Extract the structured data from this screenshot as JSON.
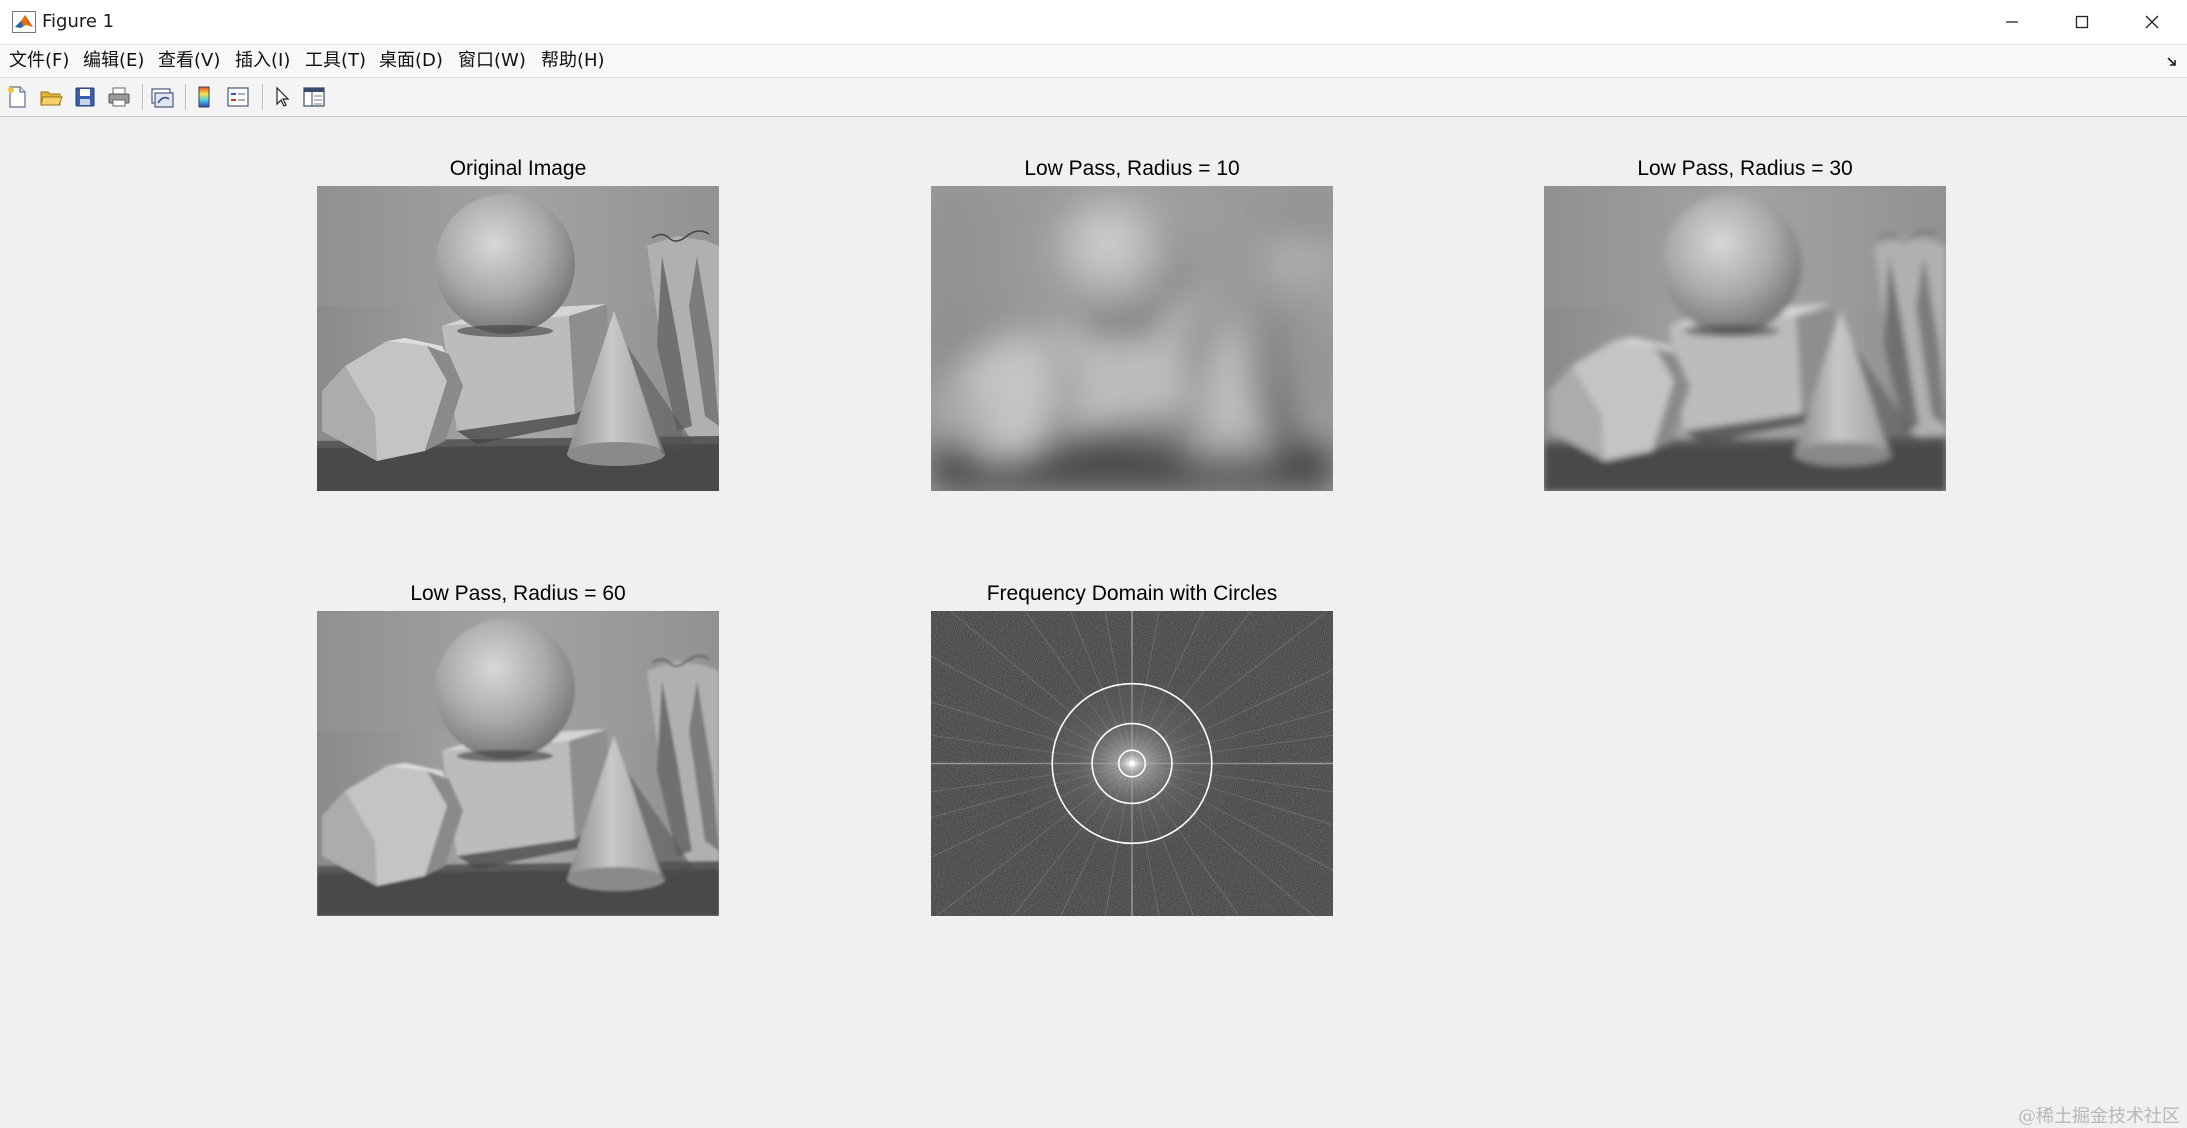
{
  "window": {
    "title": "Figure 1",
    "controls": [
      "minimize-icon",
      "maximize-icon",
      "close-icon"
    ]
  },
  "menubar": {
    "items": [
      {
        "label": "文件(F)"
      },
      {
        "label": "编辑(E)"
      },
      {
        "label": "查看(V)"
      },
      {
        "label": "插入(I)"
      },
      {
        "label": "工具(T)"
      },
      {
        "label": "桌面(D)"
      },
      {
        "label": "窗口(W)"
      },
      {
        "label": "帮助(H)"
      }
    ]
  },
  "toolbar": {
    "buttons": [
      "new-figure-icon",
      "open-file-icon",
      "save-icon",
      "print-icon",
      "link-plot-icon",
      "colorbar-icon",
      "legend-icon",
      "pointer-icon",
      "property-editor-icon"
    ]
  },
  "subplots": [
    {
      "title": "Original Image"
    },
    {
      "title": "Low Pass, Radius = 10"
    },
    {
      "title": "Low Pass, Radius = 30"
    },
    {
      "title": "Low Pass, Radius = 60"
    },
    {
      "title": "Frequency Domain with Circles"
    }
  ],
  "frequency_circles": [
    10,
    30,
    60
  ],
  "watermark": "@稀土掘金技术社区",
  "colors": {
    "window_bg": "#f0f0f0",
    "titlebar_bg": "#ffffff",
    "circle_stroke": "#ffffff"
  }
}
